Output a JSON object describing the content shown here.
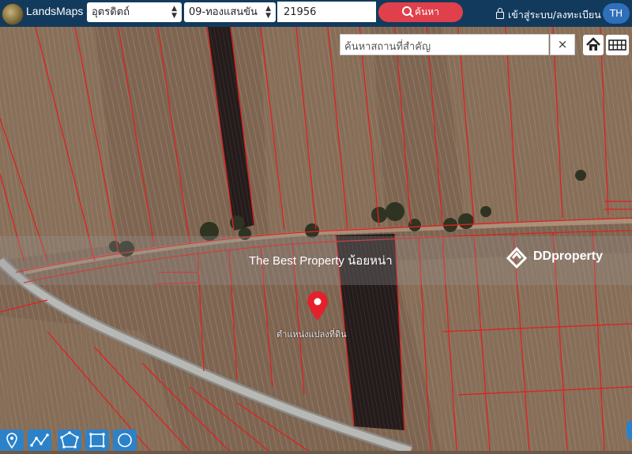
{
  "header": {
    "brand": "LandsMaps",
    "province": "อุตรดิตถ์",
    "district": "09-ทองแสนขัน",
    "parcel_number": "21956",
    "search_label": "ค้นหา",
    "login_label": "เข้าสู่ระบบ/ลงทะเบียน",
    "lang": "TH"
  },
  "map_search": {
    "placeholder": "ค้นหาสถานที่สำคัญ",
    "clear_symbol": "×"
  },
  "watermark": {
    "text": "The Best Property น้อยหน่า",
    "brand": "DDproperty"
  },
  "marker": {
    "label": "ตำแหน่งแปลงที่ดิน",
    "color": "#e4202a"
  },
  "tools": [
    "marker-tool-icon",
    "line-tool-icon",
    "polygon-tool-icon",
    "rectangle-tool-icon",
    "circle-tool-icon"
  ],
  "colors": {
    "header": "#123a5c",
    "search_button": "#e0404b",
    "parcel_lines": "#e02020",
    "tool_buttons": "#2c82c9",
    "lang_button": "#2f6fba"
  }
}
